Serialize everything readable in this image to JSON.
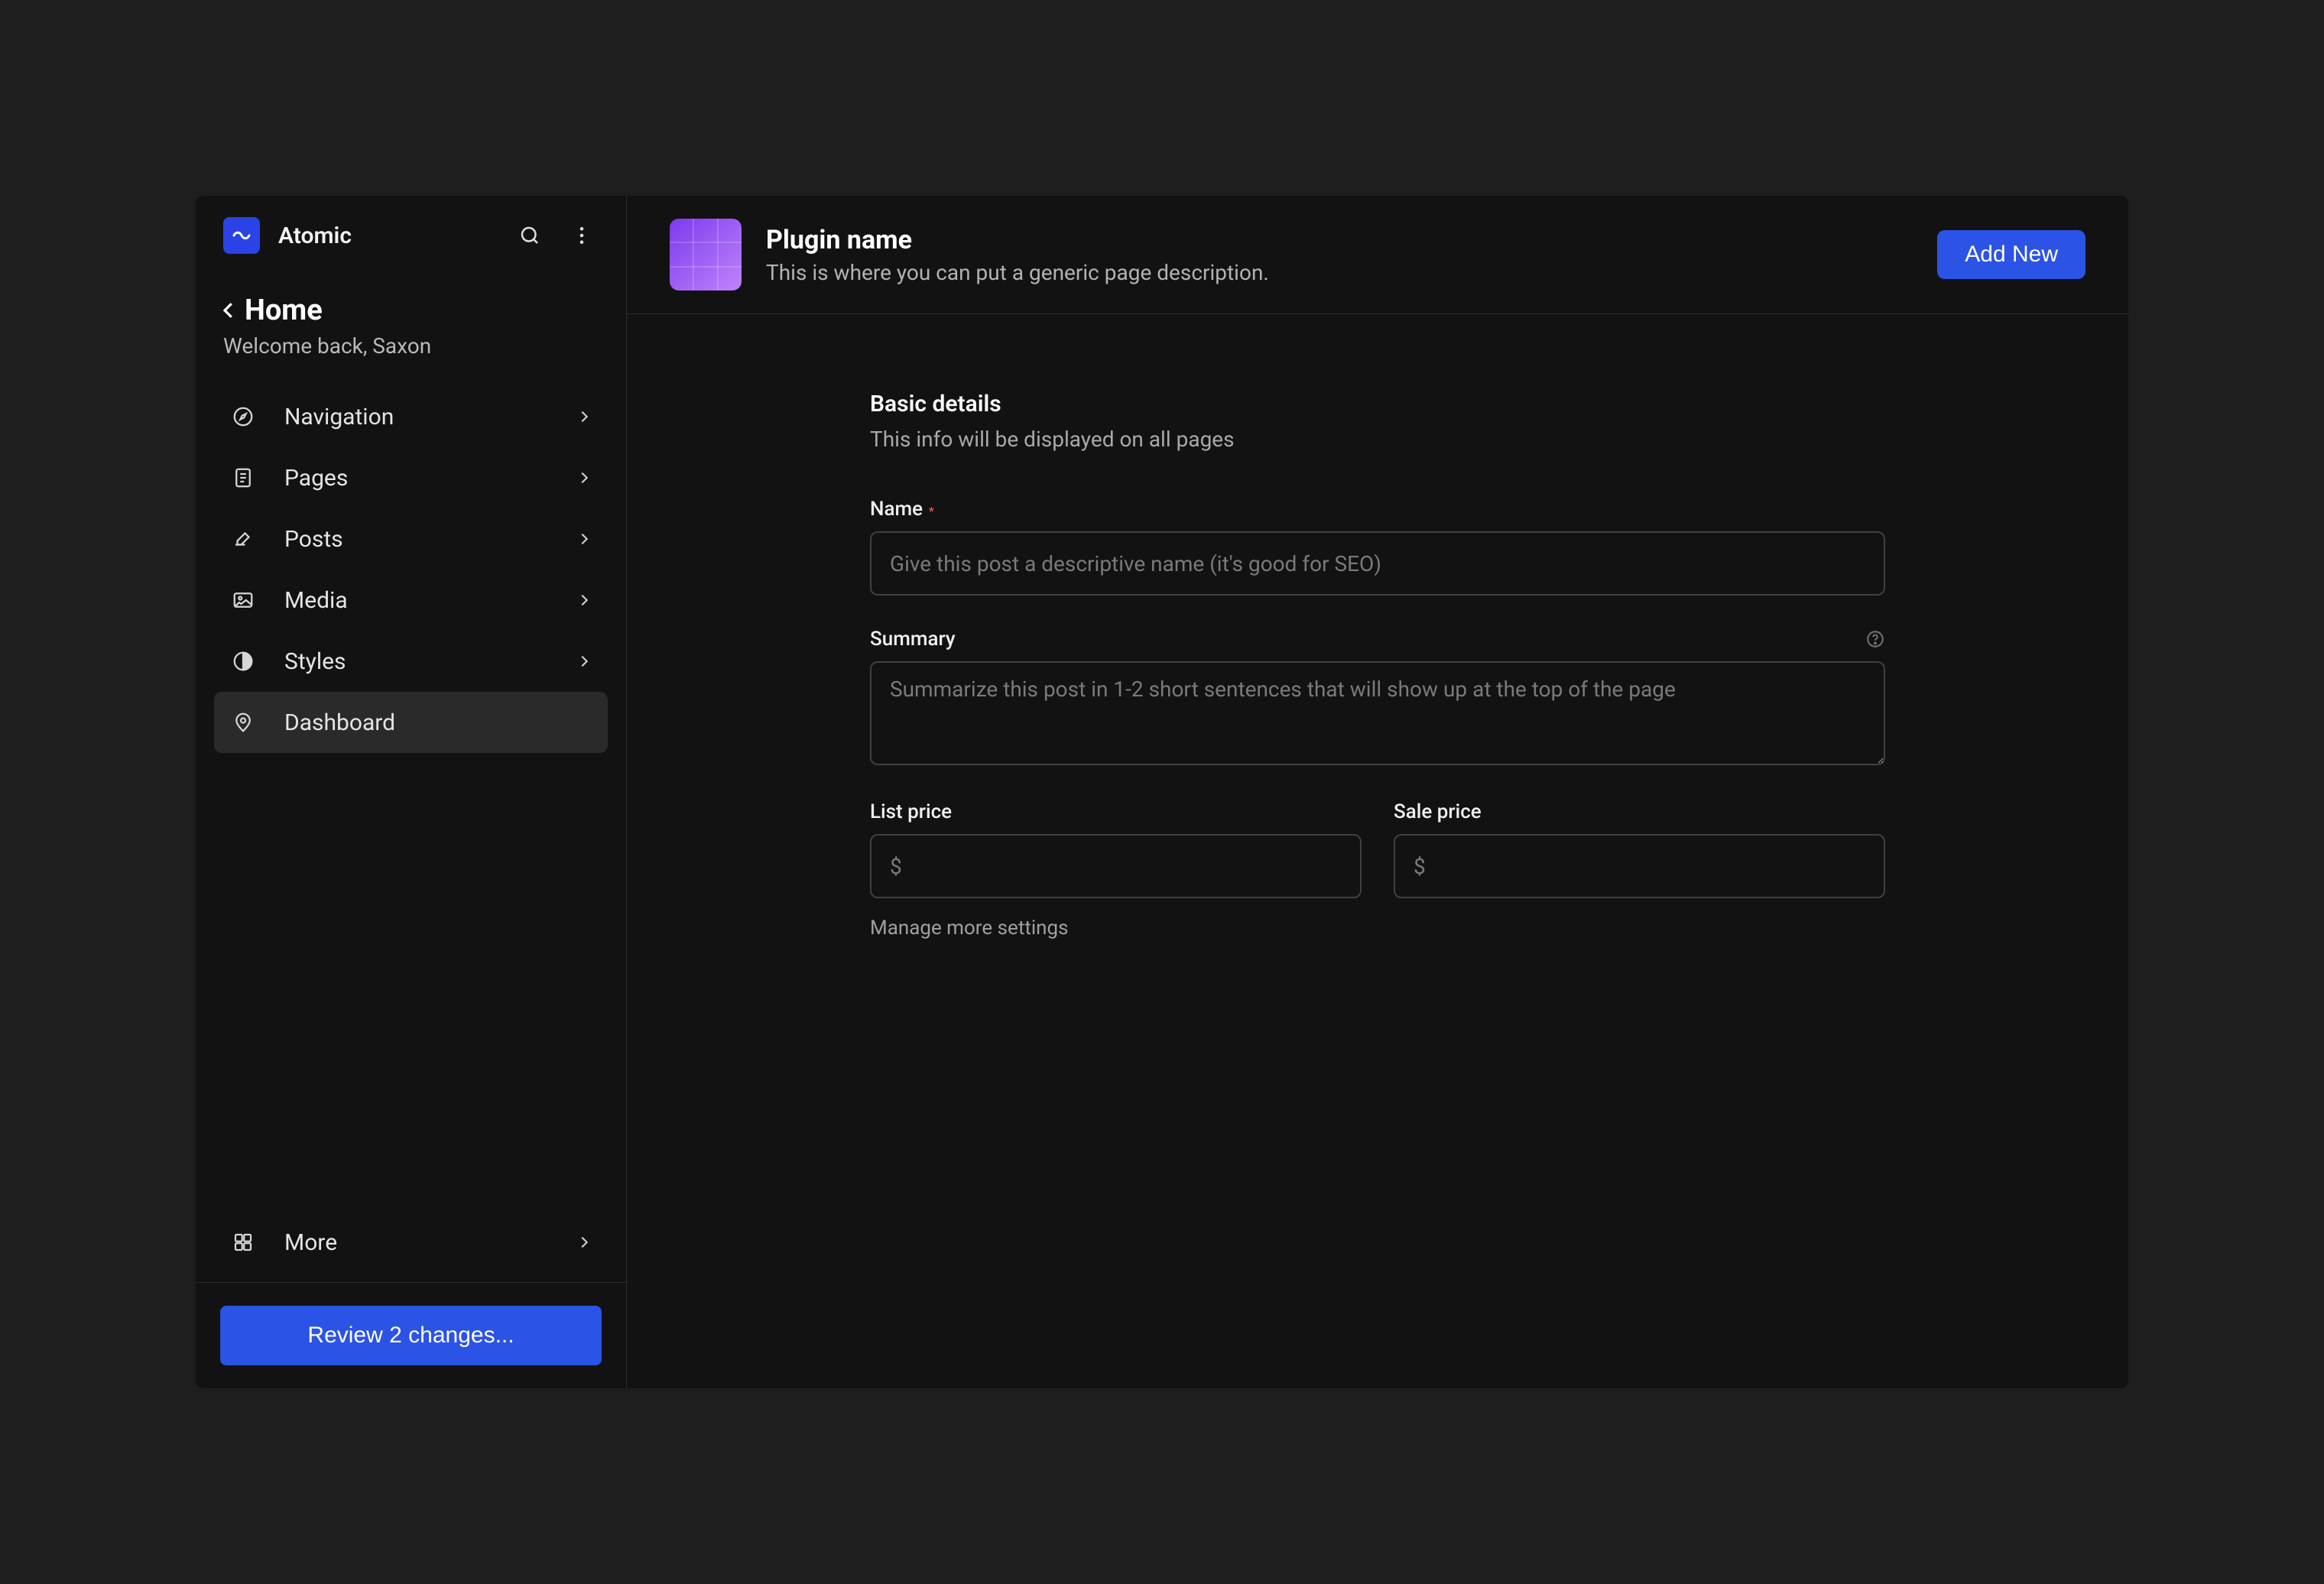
{
  "brand": {
    "name": "Atomic"
  },
  "sidebar": {
    "heading": "Home",
    "welcome": "Welcome back, Saxon",
    "items": [
      {
        "label": "Navigation",
        "has_chevron": true
      },
      {
        "label": "Pages",
        "has_chevron": true
      },
      {
        "label": "Posts",
        "has_chevron": true
      },
      {
        "label": "Media",
        "has_chevron": true
      },
      {
        "label": "Styles",
        "has_chevron": true
      },
      {
        "label": "Dashboard",
        "has_chevron": false,
        "active": true
      }
    ],
    "more_label": "More",
    "review_button": "Review 2 changes..."
  },
  "header": {
    "title": "Plugin name",
    "description": "This is where you can put a generic page description.",
    "add_new": "Add New"
  },
  "form": {
    "section_title": "Basic details",
    "section_desc": "This info will be displayed on all pages",
    "name_label": "Name",
    "name_placeholder": "Give this post a descriptive name (it's good for SEO)",
    "summary_label": "Summary",
    "summary_placeholder": "Summarize this post in 1-2 short sentences that will show up at the top of the page",
    "list_price_label": "List price",
    "list_price_placeholder": "$",
    "sale_price_label": "Sale price",
    "sale_price_placeholder": "$",
    "manage_more": "Manage more settings"
  }
}
